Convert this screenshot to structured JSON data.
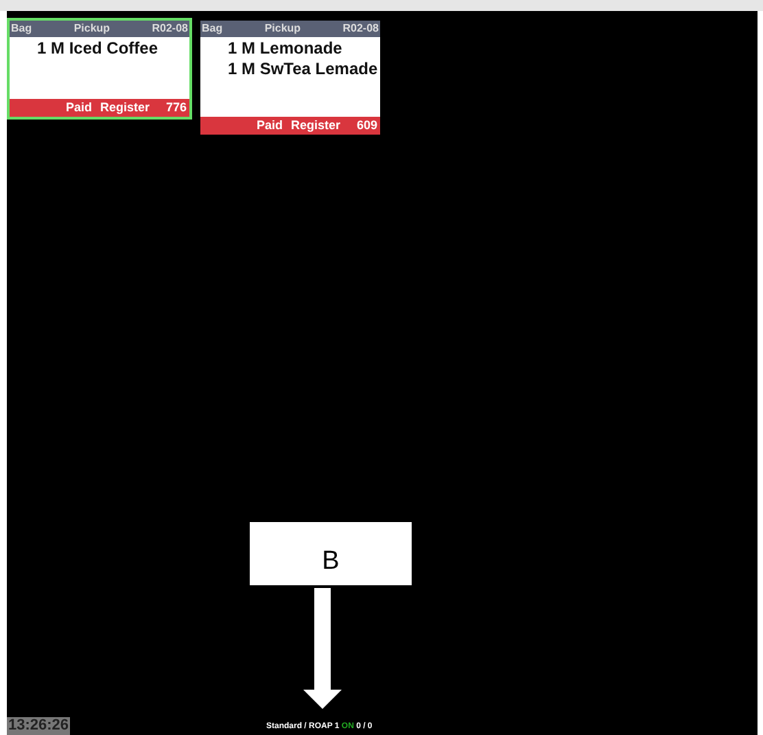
{
  "orders": [
    {
      "header": {
        "type": "Bag",
        "mode": "Pickup",
        "station": "R02-08"
      },
      "items": [
        "1 M Iced Coffee"
      ],
      "footer": {
        "payment": "Paid",
        "source": "Register",
        "number": "776"
      },
      "selected": true
    },
    {
      "header": {
        "type": "Bag",
        "mode": "Pickup",
        "station": "R02-08"
      },
      "items": [
        "1 M Lemonade",
        "1 M SwTea Lemade"
      ],
      "footer": {
        "payment": "Paid",
        "source": "Register",
        "number": "609"
      },
      "selected": false
    }
  ],
  "annotation": {
    "label": "B"
  },
  "status_bar": {
    "clock": "13:26:26",
    "segments": [
      {
        "text": "Standard / ROAP 1",
        "color": "#ffffff"
      },
      {
        "text": "ON",
        "color": "#22aa22"
      },
      {
        "text": "0 / 0",
        "color": "#ffffff"
      }
    ]
  }
}
